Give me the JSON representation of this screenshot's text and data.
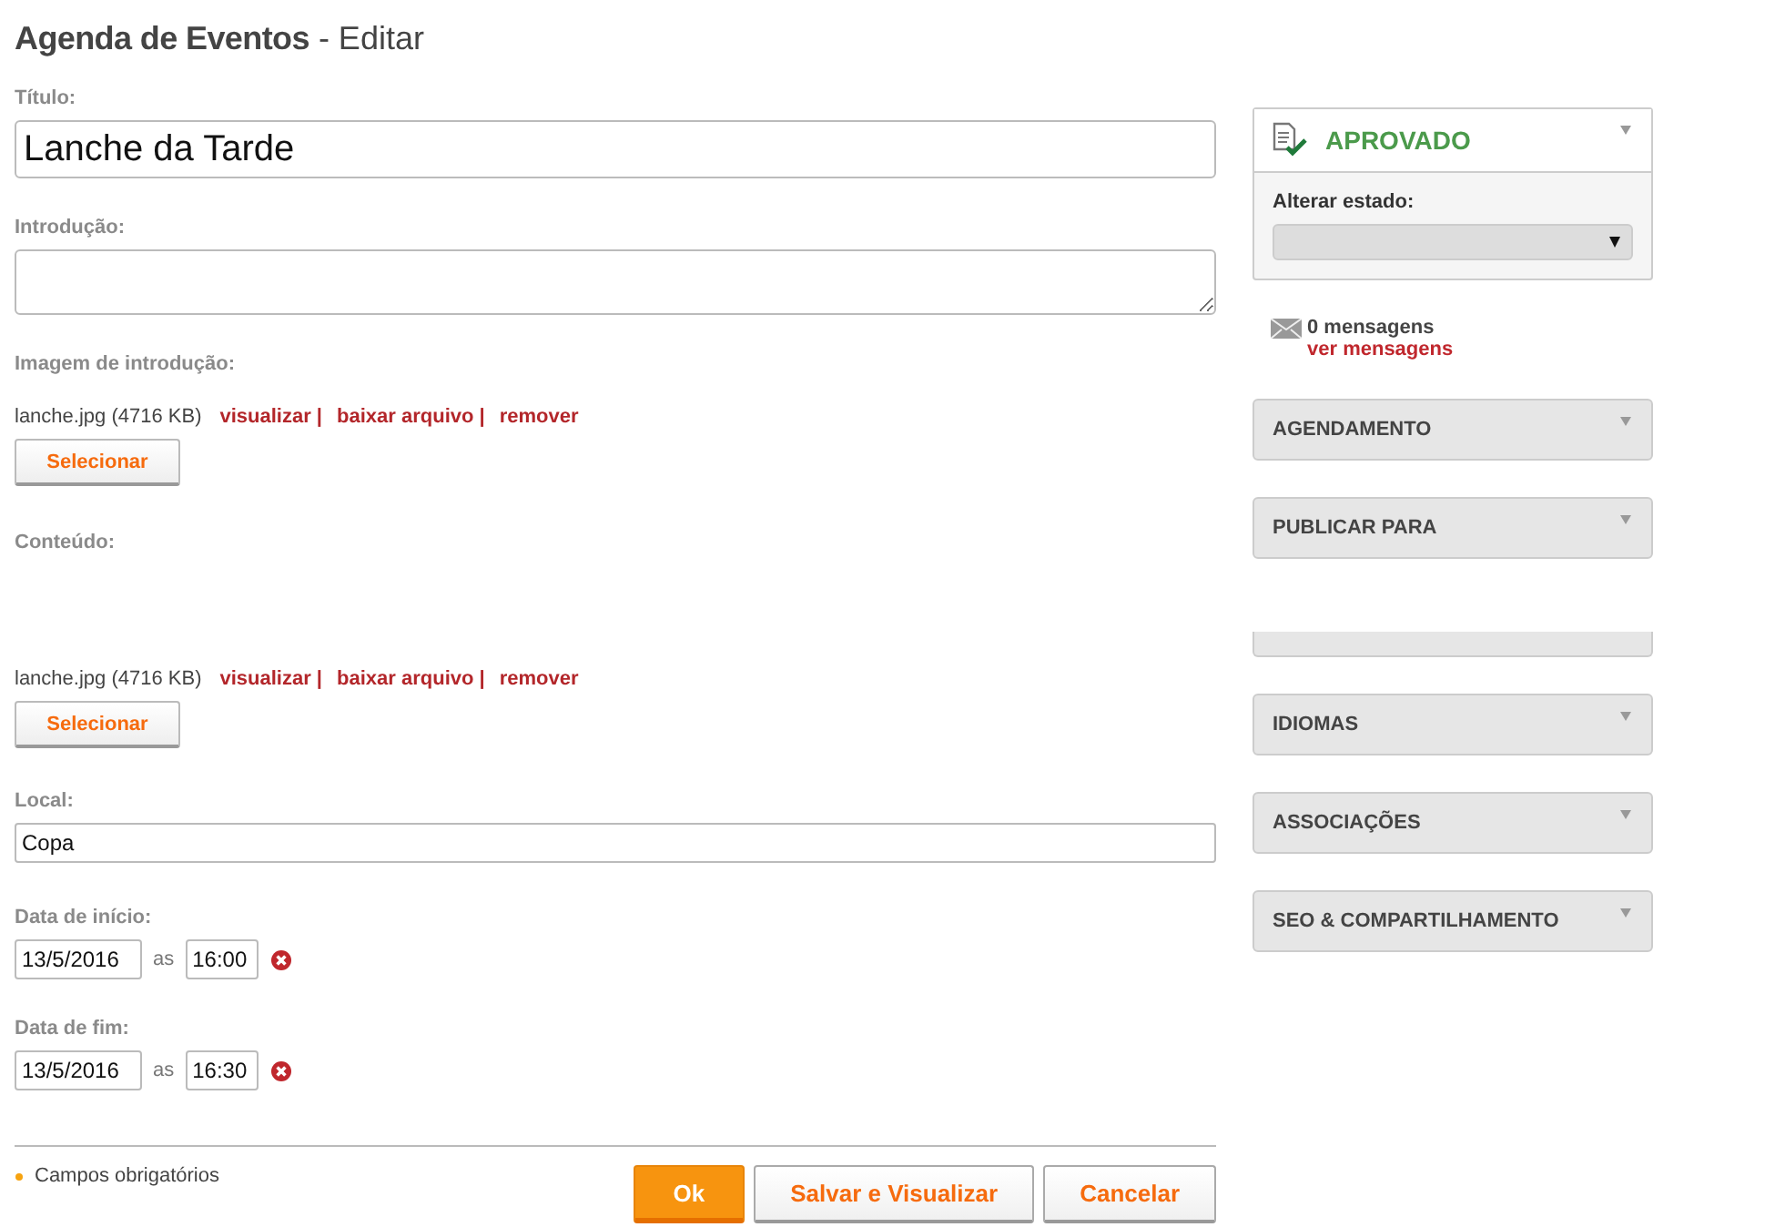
{
  "header": {
    "title": "Agenda de Eventos",
    "subtitle": "- Editar"
  },
  "form": {
    "title_field": {
      "label": "Título:",
      "value": "Lanche da Tarde"
    },
    "intro_field": {
      "label": "Introdução:"
    },
    "intro_image": {
      "label": "Imagem de introdução:",
      "file": "lanche.jpg (4716 KB)",
      "links": [
        "visualizar |",
        "baixar arquivo |",
        "remover"
      ],
      "button": "Selecionar"
    },
    "content": {
      "label": "Conteúdo:",
      "file": "lanche.jpg (4716 KB)",
      "links": [
        "visualizar |",
        "baixar arquivo |",
        "remover"
      ],
      "button": "Selecionar"
    },
    "location": {
      "label": "Local:",
      "value": "Copa"
    },
    "dates": [
      {
        "label": "Data de início:",
        "date": "13/5/2016",
        "sep": "as",
        "time": "16:00"
      },
      {
        "label": "Data de fim:",
        "date": "13/5/2016",
        "sep": "as",
        "time": "16:30"
      }
    ]
  },
  "footer": {
    "required_note": "Campos obrigatórios",
    "buttons": [
      {
        "label": "Ok",
        "kind": "primary"
      },
      {
        "label": "Salvar e Visualizar",
        "kind": "secondary"
      },
      {
        "label": "Cancelar",
        "kind": "secondary"
      }
    ]
  },
  "sidebar": {
    "status": {
      "label": "APROVADO",
      "change_label": "Alterar estado:"
    },
    "messages": {
      "count": "0 mensagens",
      "link": "ver mensagens"
    },
    "panels": [
      {
        "label": "AGENDAMENTO",
        "kind": "full"
      },
      {
        "label": "PUBLICAR PARA",
        "kind": "full"
      },
      {
        "kind": "cut"
      },
      {
        "label": "IDIOMAS",
        "kind": "full"
      },
      {
        "label": "ASSOCIAÇÕES",
        "kind": "full"
      },
      {
        "label": "SEO & COMPARTILHAMENTO",
        "kind": "full"
      }
    ]
  }
}
